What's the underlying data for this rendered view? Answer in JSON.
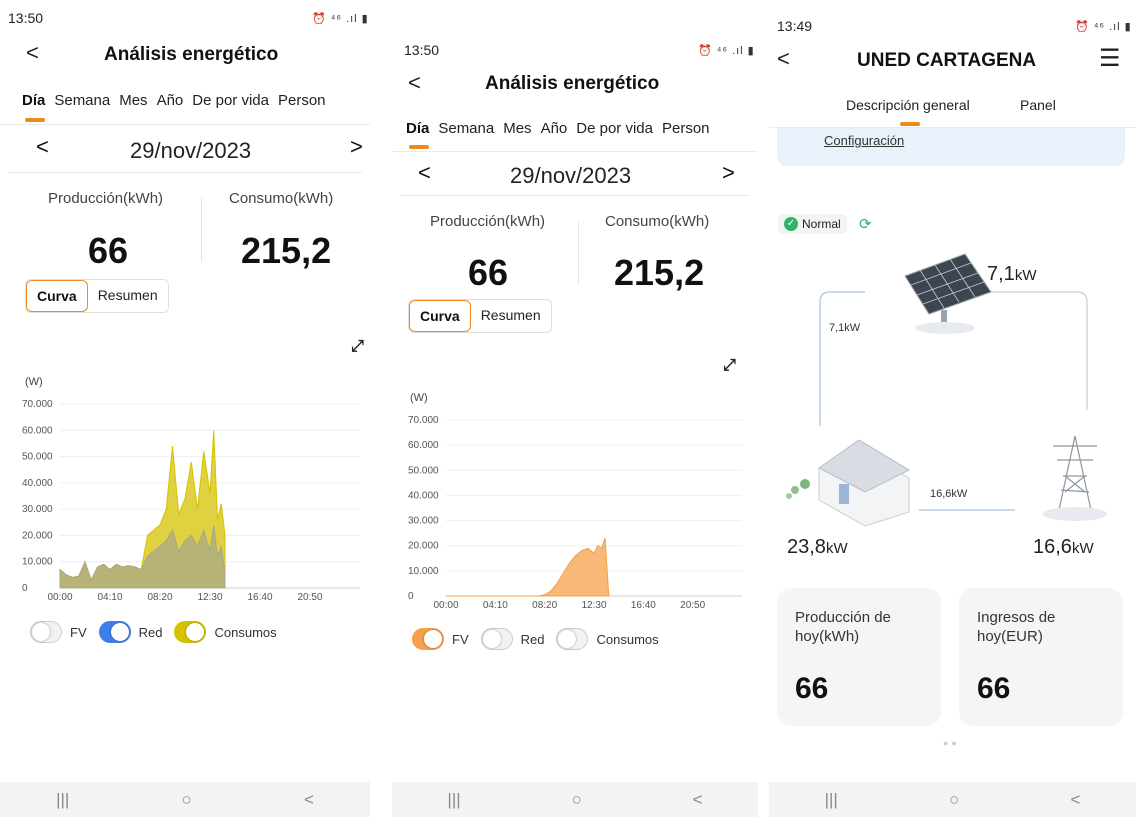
{
  "screens": [
    {
      "status_time": "13:50",
      "status_icons": "⏰ ⁴⁶ .ıl ▮",
      "back": "<",
      "title": "Análisis energético",
      "tabs": [
        "Día",
        "Semana",
        "Mes",
        "Año",
        "De por vida",
        "Person"
      ],
      "date": "29/nov/2023",
      "prev": "<",
      "next": ">",
      "metrics": [
        {
          "label": "Producción(kWh)",
          "value": "66"
        },
        {
          "label": "Consumo(kWh)",
          "value": "215,2"
        }
      ],
      "segment": [
        "Curva",
        "Resumen"
      ],
      "unit": "(W)",
      "legend": [
        {
          "label": "FV",
          "state": "off",
          "color": "#cccccc"
        },
        {
          "label": "Red",
          "state": "on",
          "color": "#3f7ee8"
        },
        {
          "label": "Consumos",
          "state": "on",
          "color": "#d6c200"
        }
      ]
    },
    {
      "status_time": "13:50",
      "status_icons": "⏰ ⁴⁶ .ıl ▮",
      "back": "<",
      "title": "Análisis energético",
      "tabs": [
        "Día",
        "Semana",
        "Mes",
        "Año",
        "De por vida",
        "Person"
      ],
      "date": "29/nov/2023",
      "prev": "<",
      "next": ">",
      "metrics": [
        {
          "label": "Producción(kWh)",
          "value": "66"
        },
        {
          "label": "Consumo(kWh)",
          "value": "215,2"
        }
      ],
      "segment": [
        "Curva",
        "Resumen"
      ],
      "unit": "(W)",
      "legend": [
        {
          "label": "FV",
          "state": "on",
          "color": "#f5a04a"
        },
        {
          "label": "Red",
          "state": "off",
          "color": "#cccccc"
        },
        {
          "label": "Consumos",
          "state": "off",
          "color": "#cccccc"
        }
      ]
    }
  ],
  "chart_data": [
    {
      "type": "area",
      "y_ticks": [
        "0",
        "10.000",
        "20.000",
        "30.000",
        "40.000",
        "50.000",
        "60.000",
        "70.000"
      ],
      "x_ticks": [
        "00:00",
        "04:10",
        "08:20",
        "12:30",
        "16:40",
        "20:50"
      ],
      "ylim": [
        0,
        70000
      ],
      "xlim_hours": [
        0,
        24
      ],
      "series": [
        {
          "name": "Consumos",
          "color": "#d6c200",
          "x": [
            0,
            0.5,
            1,
            1.5,
            2,
            2.5,
            3,
            3.5,
            4,
            4.5,
            5,
            5.5,
            6,
            6.5,
            7,
            7.5,
            8,
            8.5,
            9,
            9.5,
            10,
            10.5,
            11,
            11.5,
            12,
            12.3,
            12.6,
            12.9,
            13.2
          ],
          "y": [
            7000,
            5000,
            4000,
            4500,
            10000,
            3000,
            8000,
            9000,
            7000,
            9000,
            8000,
            8500,
            8000,
            7000,
            20000,
            22000,
            24000,
            30000,
            54000,
            28000,
            34000,
            48000,
            30000,
            52000,
            36000,
            60000,
            26000,
            32000,
            20000
          ]
        },
        {
          "name": "Red",
          "color": "#a9a88a",
          "x": [
            0,
            0.5,
            1,
            1.5,
            2,
            2.5,
            3,
            3.5,
            4,
            4.5,
            5,
            5.5,
            6,
            6.5,
            7,
            7.5,
            8,
            8.5,
            9,
            9.5,
            10,
            10.5,
            11,
            11.5,
            12,
            12.3,
            12.6,
            12.9,
            13.2
          ],
          "y": [
            7000,
            5000,
            4000,
            4500,
            10000,
            3000,
            8000,
            9000,
            7000,
            9000,
            8000,
            8500,
            8000,
            7000,
            12000,
            14000,
            16000,
            18000,
            22000,
            14000,
            18000,
            20000,
            16000,
            22000,
            14000,
            24000,
            12000,
            16000,
            6000
          ]
        }
      ]
    },
    {
      "type": "area",
      "y_ticks": [
        "0",
        "10.000",
        "20.000",
        "30.000",
        "40.000",
        "50.000",
        "60.000",
        "70.000"
      ],
      "x_ticks": [
        "00:00",
        "04:10",
        "08:20",
        "12:30",
        "16:40",
        "20:50"
      ],
      "ylim": [
        0,
        70000
      ],
      "xlim_hours": [
        0,
        24
      ],
      "series": [
        {
          "name": "FV",
          "color": "#f5a04a",
          "x": [
            0,
            7.5,
            8,
            8.5,
            9,
            9.5,
            10,
            10.5,
            11,
            11.5,
            12,
            12.3,
            12.6,
            12.9,
            13.2
          ],
          "y": [
            0,
            0,
            500,
            2000,
            5000,
            9000,
            13000,
            16000,
            18000,
            19000,
            17000,
            20000,
            19000,
            23000,
            0
          ]
        }
      ]
    }
  ],
  "screen3": {
    "status_time": "13:49",
    "status_icons": "⏰ ⁴⁶ .ıl ▮",
    "back": "<",
    "title": "UNED CARTAGENA",
    "menu": "☰",
    "tabs": [
      "Descripción general",
      "Panel"
    ],
    "config_link": "Configuración",
    "status": "Normal",
    "pv_power": "7,1",
    "pv_unit": "kW",
    "flow_pv_home": "7,1kW",
    "flow_home_grid": "16,6kW",
    "home_power": "23,8",
    "home_unit": "kW",
    "grid_power": "16,6",
    "grid_unit": "kW",
    "cards": [
      {
        "label": "Producción de hoy(kWh)",
        "value": "66"
      },
      {
        "label": "Ingresos de hoy(EUR)",
        "value": "66"
      }
    ]
  },
  "navbar": {
    "recent": "|||",
    "home": "○",
    "back": "<"
  }
}
